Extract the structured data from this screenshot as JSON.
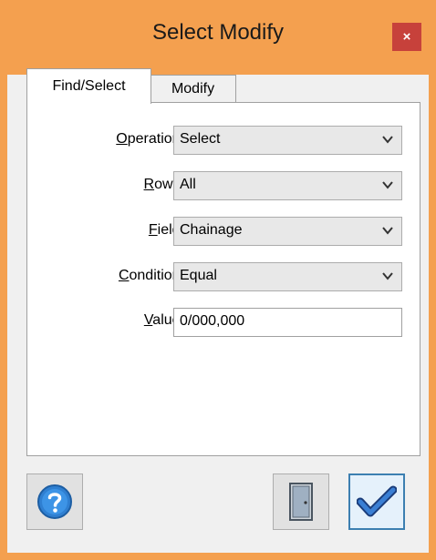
{
  "window": {
    "title": "Select Modify",
    "close_glyph": "×"
  },
  "tabs": [
    {
      "label": "Find/Select",
      "active": true
    },
    {
      "label": "Modify",
      "active": false
    }
  ],
  "form": {
    "operation": {
      "label_underline": "O",
      "label_rest": "peration:",
      "value": "Select"
    },
    "rows": {
      "label_underline": "R",
      "label_rest": "ows:",
      "value": "All"
    },
    "field": {
      "label_underline": "F",
      "label_rest": "ield:",
      "value": "Chainage"
    },
    "condition": {
      "label_underline": "C",
      "label_rest": "ondition:",
      "value": "Equal"
    },
    "value": {
      "label_underline": "V",
      "label_rest": "alue:",
      "value": "0/000,000"
    }
  },
  "buttons": {
    "help_icon": "question-mark-icon",
    "exit_icon": "door-icon",
    "ok_icon": "checkmark-icon"
  },
  "colors": {
    "title_bar": "#f4a04f",
    "close_button": "#c7413b",
    "ok_border": "#3c7fb1"
  }
}
